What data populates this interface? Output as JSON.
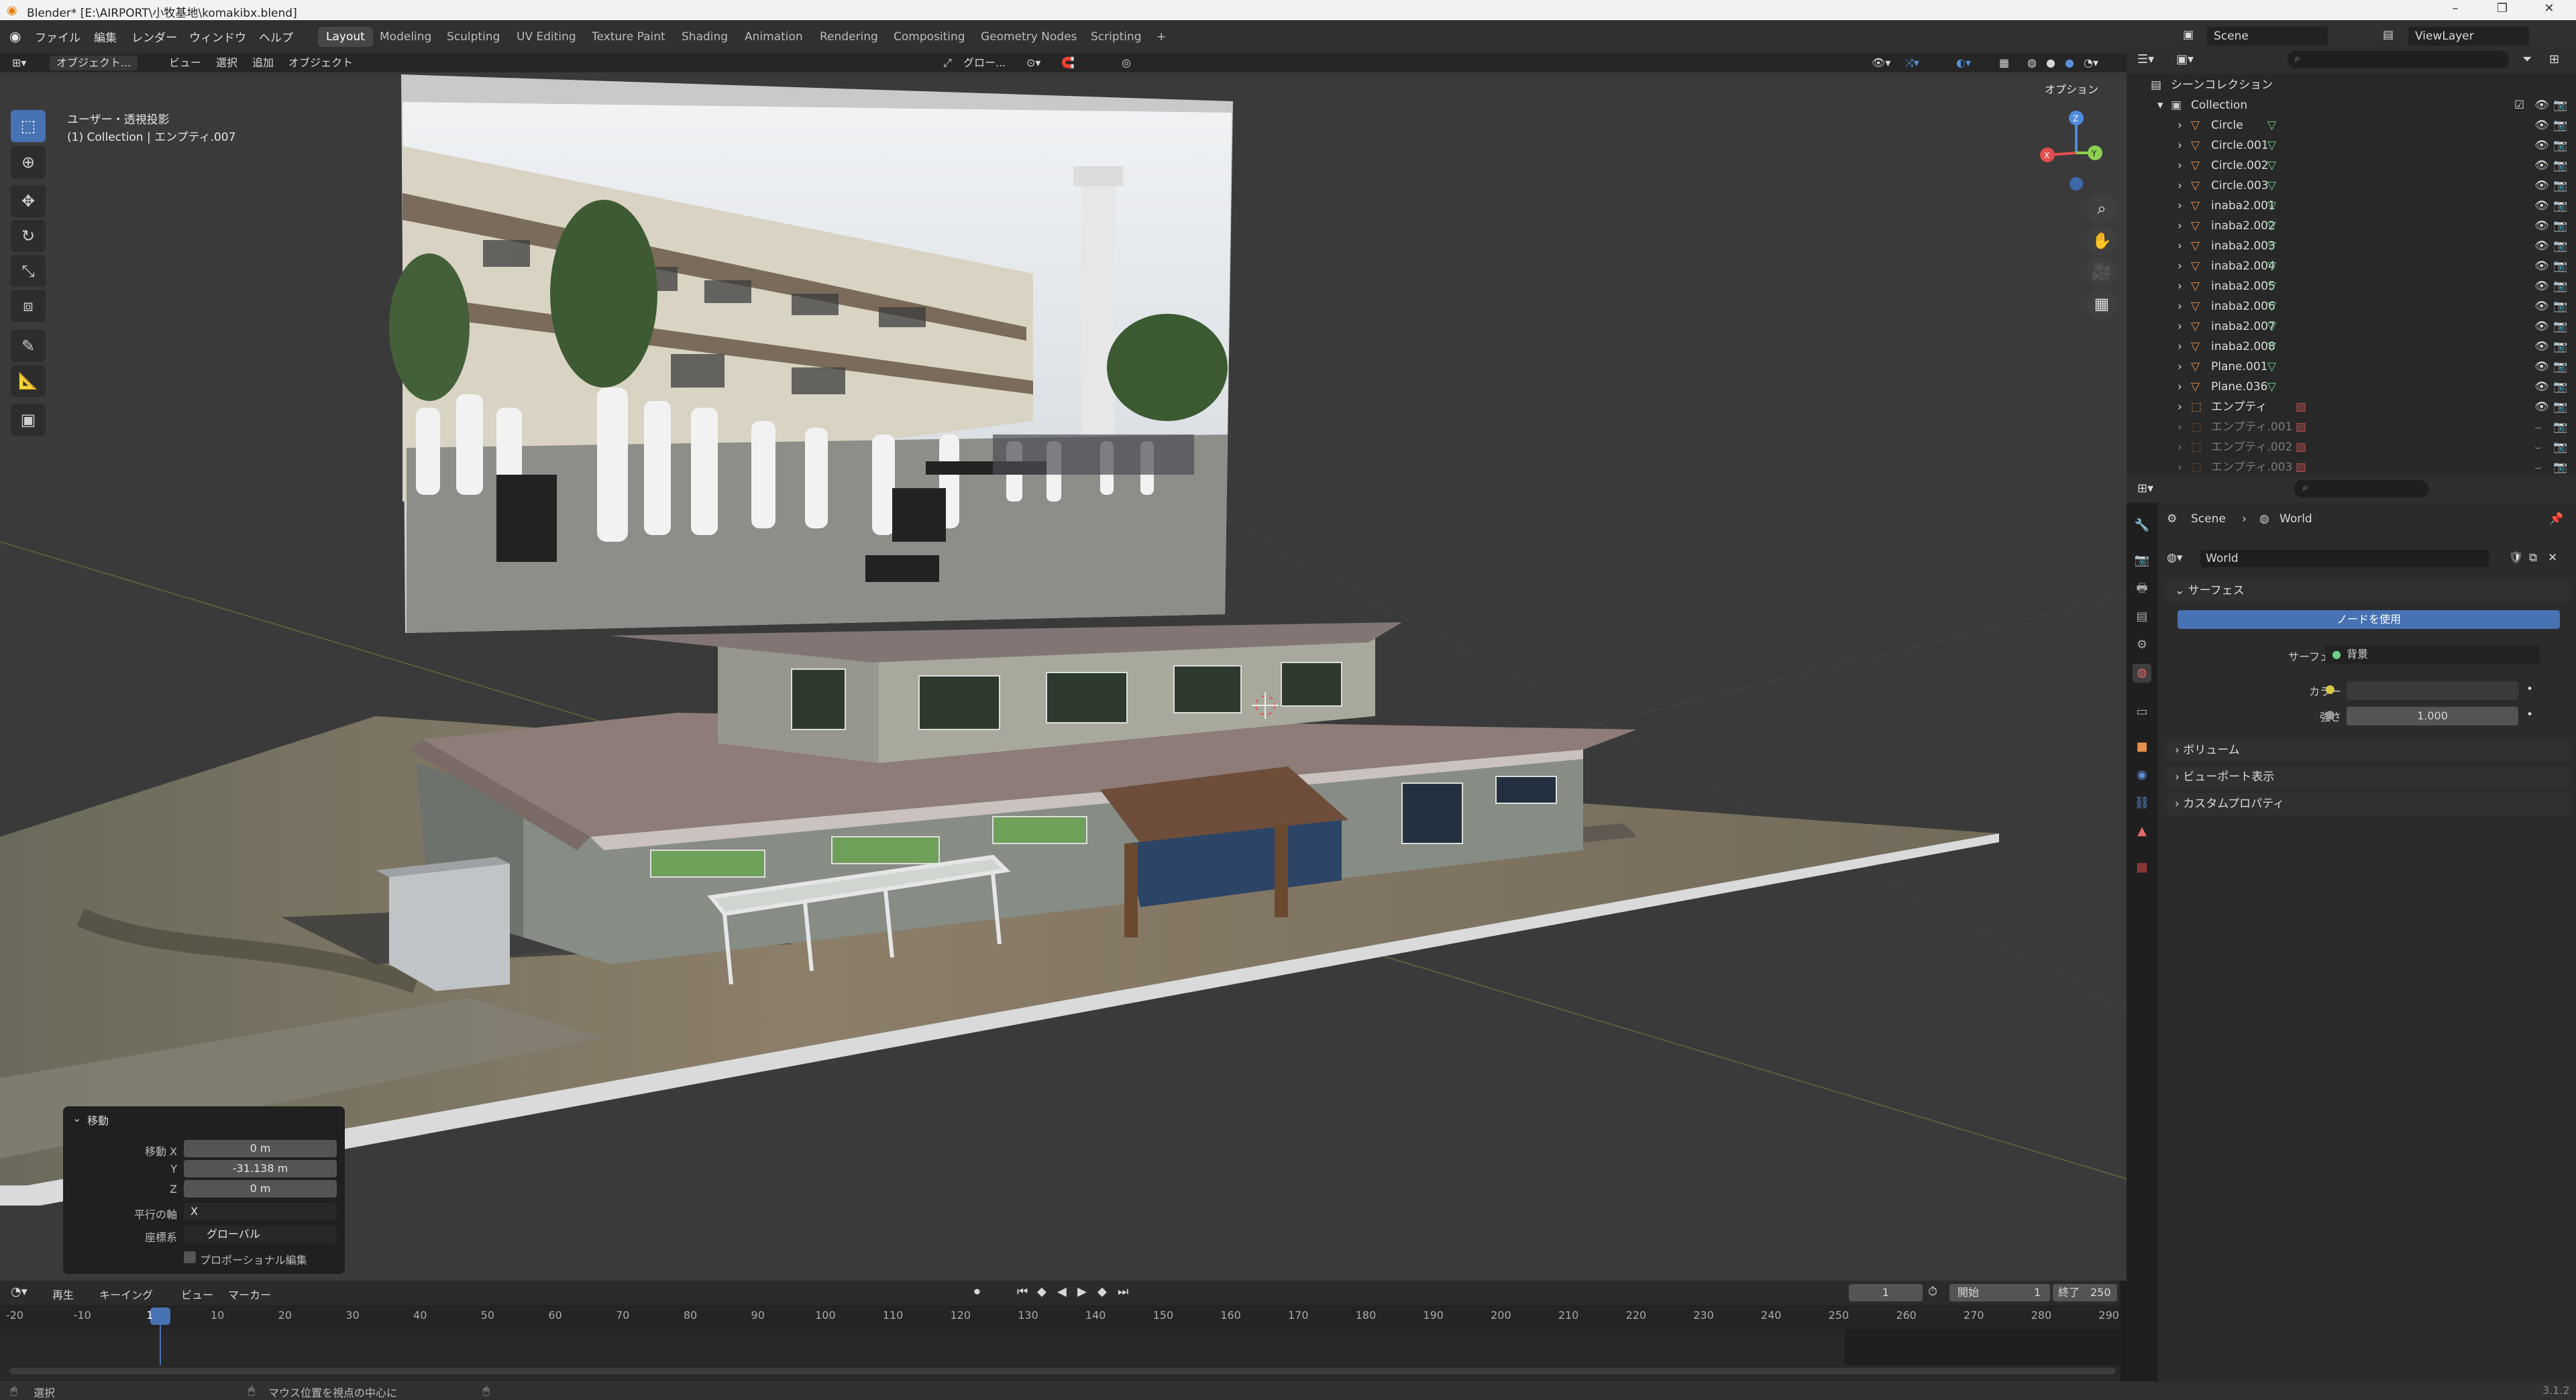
{
  "window_title": "Blender* [E:\\AIRPORT\\小牧基地\\komakibx.blend]",
  "menu": [
    "ファイル",
    "編集",
    "レンダー",
    "ウィンドウ",
    "ヘルプ"
  ],
  "workspaces": [
    "Layout",
    "Modeling",
    "Sculpting",
    "UV Editing",
    "Texture Paint",
    "Shading",
    "Animation",
    "Rendering",
    "Compositing",
    "Geometry Nodes",
    "Scripting"
  ],
  "active_workspace": "Layout",
  "scene_name": "Scene",
  "view_layer": "ViewLayer",
  "viewport": {
    "mode": "オブジェクト...",
    "menus": [
      "ビュー",
      "選択",
      "追加",
      "オブジェクト"
    ],
    "transform_orientation": "グロー...",
    "options_label": "オプション",
    "projection": "ユーザー・透視投影",
    "context": "(1) Collection | エンプティ.007"
  },
  "operator_panel": {
    "title": "移動",
    "move_x_label": "移動 X",
    "move_x": "0 m",
    "y_label": "Y",
    "move_y": "-31.138 m",
    "z_label": "Z",
    "move_z": "0 m",
    "axis_label": "平行の軸",
    "axis": "X",
    "orientation_label": "座標系",
    "orientation": "グローバル",
    "proportional": "プロポーショナル編集"
  },
  "outliner": {
    "root": "シーンコレクション",
    "collection": "Collection",
    "items": [
      {
        "name": "Circle",
        "dim": false
      },
      {
        "name": "Circle.001",
        "dim": false
      },
      {
        "name": "Circle.002",
        "dim": false
      },
      {
        "name": "Circle.003",
        "dim": false
      },
      {
        "name": "inaba2.001",
        "dim": false
      },
      {
        "name": "inaba2.002",
        "dim": false
      },
      {
        "name": "inaba2.003",
        "dim": false
      },
      {
        "name": "inaba2.004",
        "dim": false
      },
      {
        "name": "inaba2.005",
        "dim": false
      },
      {
        "name": "inaba2.006",
        "dim": false
      },
      {
        "name": "inaba2.007",
        "dim": false
      },
      {
        "name": "inaba2.008",
        "dim": false
      },
      {
        "name": "Plane.001",
        "dim": false
      },
      {
        "name": "Plane.036",
        "dim": false
      },
      {
        "name": "エンプティ",
        "dim": false
      },
      {
        "name": "エンプティ.001",
        "dim": true
      },
      {
        "name": "エンプティ.002",
        "dim": true
      },
      {
        "name": "エンプティ.003",
        "dim": true
      }
    ]
  },
  "properties": {
    "breadcrumb_scene": "Scene",
    "breadcrumb_world": "World",
    "world_name": "World",
    "surface_section": "サーフェス",
    "use_nodes": "ノードを使用",
    "surface_label": "サーフェス",
    "surface_value": "背景",
    "color_label": "カラー",
    "strength_label": "強さ",
    "strength_value": "1.000",
    "volume_section": "ボリューム",
    "viewport_display_section": "ビューポート表示",
    "custom_props_section": "カスタムプロパティ"
  },
  "timeline": {
    "menus": [
      "再生",
      "キーイング",
      "ビュー",
      "マーカー"
    ],
    "current_frame": "1",
    "start_label": "開始",
    "start": "1",
    "end_label": "終了",
    "end": "250",
    "ticks": [
      "-20",
      "-10",
      "1",
      "10",
      "20",
      "30",
      "40",
      "50",
      "60",
      "70",
      "80",
      "90",
      "100",
      "110",
      "120",
      "130",
      "140",
      "150",
      "160",
      "170",
      "180",
      "190",
      "200",
      "210",
      "220",
      "230",
      "240",
      "250",
      "260",
      "270",
      "280",
      "290"
    ]
  },
  "status": {
    "select": "選択",
    "center": "マウス位置を視点の中心に",
    "version": "3.1.2"
  },
  "colors": {
    "accent": "#4772b3",
    "object_orange": "#e8904a",
    "mesh_green": "#6ecf8a"
  }
}
